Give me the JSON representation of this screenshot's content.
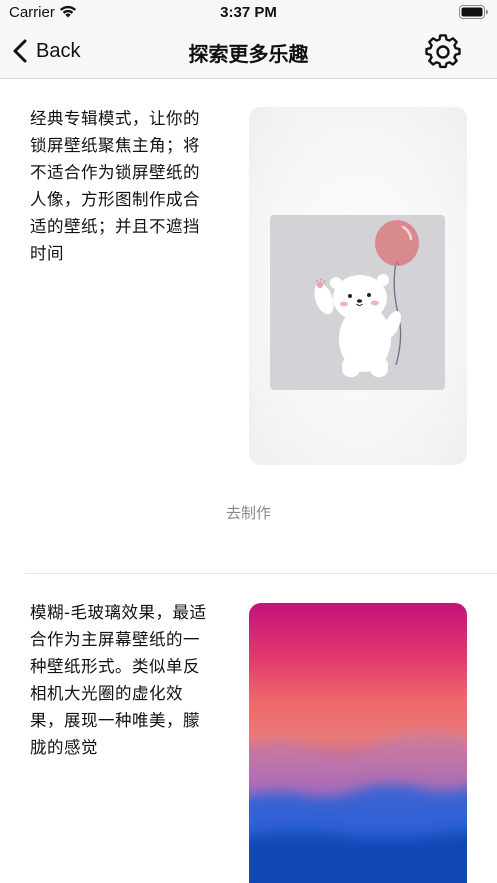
{
  "status_bar": {
    "carrier": "Carrier",
    "time": "3:37 PM",
    "wifi_icon": "wifi-icon",
    "battery_icon": "battery-icon"
  },
  "nav": {
    "back_label": "Back",
    "title": "探索更多乐趣",
    "back_icon": "chevron-left-icon",
    "settings_icon": "gear-icon"
  },
  "cards": [
    {
      "description_lines": [
        "经典专辑模式，让你的",
        "锁屏壁纸聚焦主角；将",
        "不适合作为锁屏壁纸的",
        "人像，方形图制作成合",
        "适的壁纸；并且不遮挡",
        "时间"
      ],
      "preview": "polar-bear-with-balloon-illustration",
      "action_label": "去制作"
    },
    {
      "description_lines": [
        "模糊-毛玻璃效果，最适",
        "合作为主屏幕壁纸的一",
        "种壁纸形式。类似单反",
        "相机大光圈的虚化效",
        "果，展现一种唯美，朦",
        "胧的感觉"
      ],
      "preview": "blurred-sunset-gradient"
    }
  ],
  "colors": {
    "bar_background": "#f7f7f7",
    "action_text": "#8a8a8a",
    "inner_photo_bg": "#d3d2d7",
    "balloon": "#d98a8f"
  }
}
